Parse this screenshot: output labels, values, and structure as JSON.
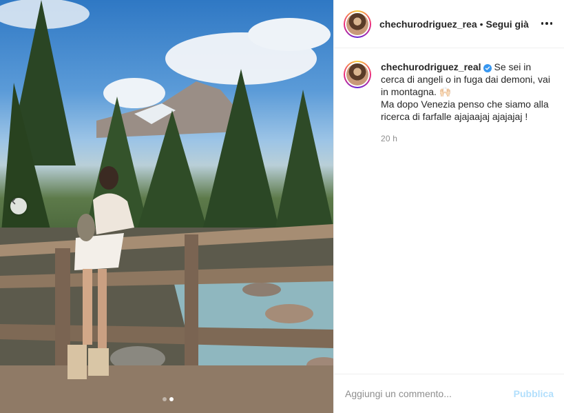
{
  "post": {
    "photo": {
      "alt_semantic": "woman-on-wooden-bridge-mountain-scene",
      "carousel_dots": 2,
      "active_dot": 2,
      "prev_icon": "chevron-left-icon"
    },
    "header": {
      "username": "chechurodriguez_rea",
      "separator": "•",
      "follow_label": "Segui già",
      "more_icon": "more-horizontal-icon"
    },
    "caption": {
      "username": "chechurodriguez_real",
      "verified_icon": "verified-badge-icon",
      "text_line1": "Se sei in cerca di angeli o in fuga dai demoni, vai in montagna. 🙌🏻",
      "text_line2": "Ma dopo Venezia penso che siamo alla ricerca di farfalle ajajaajaj ajajajaj !",
      "timestamp": "20 h"
    },
    "comment": {
      "placeholder": "Aggiungi un commento...",
      "publish_label": "Pubblica"
    },
    "colors": {
      "link_disabled": "#b2dffc",
      "verified": "#3897f0",
      "muted_text": "#8e8e8e",
      "border": "#efefef"
    }
  }
}
